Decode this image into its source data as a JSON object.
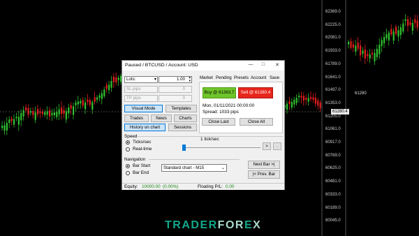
{
  "axis": {
    "right_ticks": [
      "62369.0",
      "62225.0",
      "62081.0",
      "61933.0",
      "61789.0",
      "61641.0",
      "61497.0",
      "61353.0",
      "61205.0",
      "61061.0",
      "60917.0",
      "60769.0",
      "60625.0",
      "60481.0",
      "60333.0",
      "60189.0",
      "60045.0"
    ],
    "price_tag": "61280.4",
    "mid_tag": "61280"
  },
  "dialog": {
    "title": "Paused / BTCUSD / Account: USD",
    "window_buttons": {
      "minimize": "—",
      "maximize": "□",
      "close": "✕"
    },
    "lots_label": "Lots:",
    "lots_value": "1.00",
    "sl_label": "SL pips",
    "sl_value": "0",
    "tp_label": "TP pips",
    "tp_value": "0",
    "visual_mode": "Visual Mode",
    "templates": "Templates",
    "trades": "Trades",
    "news": "News",
    "charts": "Charts",
    "history_on_chart": "History on chart",
    "sessions": "Sessions",
    "tabs": [
      "Market",
      "Pending",
      "Presets",
      "Account",
      "Save"
    ],
    "buy_button": "Buy @ 61383.7",
    "sell_button": "Sell @ 61280.4",
    "datetime": "Mon, 01/11/2021 00:00:00",
    "spread": "Spread: 1033 pips",
    "close_last": "Close Last",
    "close_all": "Close All",
    "speed_label": "Speed",
    "ticks_sec": "Ticks/sec",
    "real_time": "Real-time",
    "speed_value": "1 tick/sec",
    "play": ">",
    "more": "...",
    "navigation_label": "Navigation",
    "bar_start": "Bar Start",
    "bar_end": "Bar End",
    "chart_select": "Standard chart - M15",
    "next_bar": "Next Bar >|",
    "prev_bar": "|< Prev. Bar",
    "equity_label": "Equity:",
    "equity_value": "10000.00",
    "equity_pct": "(0.00%)",
    "floating_label": "Floating P/L:",
    "floating_value": "0.00"
  },
  "watermark": {
    "part1": "TRADER",
    "part2": "FOR",
    "part3": "E",
    "part4": "X"
  },
  "colors": {
    "bull": "#2fc22f",
    "bear": "#e21e1e",
    "buy": "#6fc52a",
    "sell": "#e8261c",
    "accent": "#0078d7"
  }
}
